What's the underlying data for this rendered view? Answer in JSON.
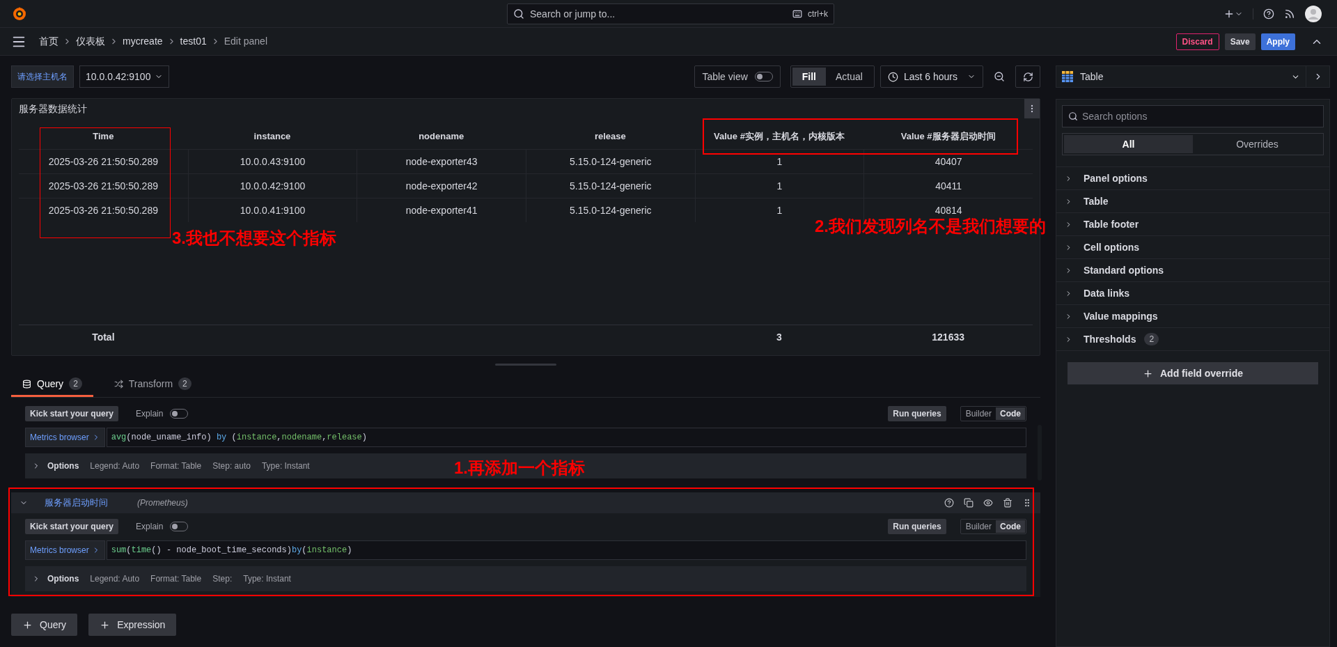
{
  "topbar": {
    "search": {
      "placeholder": "Search or jump to...",
      "shortcut": "ctrl+k"
    }
  },
  "breadcrumbs": [
    {
      "label": "首页"
    },
    {
      "label": "仪表板"
    },
    {
      "label": "mycreate"
    },
    {
      "label": "test01"
    },
    {
      "label": "Edit panel",
      "current": true
    }
  ],
  "actions": [
    {
      "label": "Discard",
      "kind": "danger"
    },
    {
      "label": "Save",
      "kind": "secondary"
    },
    {
      "label": "Apply",
      "kind": "primary"
    }
  ],
  "variable": {
    "label": "请选择主机名",
    "value": "10.0.0.42:9100"
  },
  "toolbar": {
    "table_view": {
      "label": "Table view",
      "on": false
    },
    "modes": [
      {
        "label": "Fill",
        "selected": true
      },
      {
        "label": "Actual",
        "selected": false
      }
    ],
    "time_range": "Last 6 hours"
  },
  "panel": {
    "title": "服务器数据统计",
    "columns": [
      "Time",
      "instance",
      "nodename",
      "release",
      "Value #实例，主机名，内核版本",
      "Value #服务器启动时间"
    ],
    "rows": [
      [
        "2025-03-26 21:50:50.289",
        "10.0.0.43:9100",
        "node-exporter43",
        "5.15.0-124-generic",
        "1",
        "40407"
      ],
      [
        "2025-03-26 21:50:50.289",
        "10.0.0.42:9100",
        "node-exporter42",
        "5.15.0-124-generic",
        "1",
        "40411"
      ],
      [
        "2025-03-26 21:50:50.289",
        "10.0.0.41:9100",
        "node-exporter41",
        "5.15.0-124-generic",
        "1",
        "40814"
      ]
    ],
    "footer": {
      "label": "Total",
      "value_totals": [
        "3",
        "121633"
      ]
    }
  },
  "query_tabs": [
    {
      "label": "Query",
      "count": "2",
      "selected": true
    },
    {
      "label": "Transform",
      "count": "2",
      "selected": false
    }
  ],
  "queries": [
    {
      "kick_start": "Kick start your query",
      "explain": {
        "label": "Explain",
        "on": false
      },
      "run": "Run queries",
      "editor_modes": [
        {
          "label": "Builder",
          "selected": false
        },
        {
          "label": "Code",
          "selected": true
        }
      ],
      "metrics_browser": "Metrics browser",
      "tokens": [
        {
          "text": "avg",
          "kind": "fn"
        },
        {
          "text": "(node_uname_info) ",
          "kind": "text"
        },
        {
          "text": "by",
          "kind": "keyword"
        },
        {
          "text": " (",
          "kind": "text"
        },
        {
          "text": "instance",
          "kind": "label"
        },
        {
          "text": ",",
          "kind": "text"
        },
        {
          "text": "nodename",
          "kind": "label"
        },
        {
          "text": ",",
          "kind": "text"
        },
        {
          "text": "release",
          "kind": "label"
        },
        {
          "text": ")",
          "kind": "text"
        }
      ],
      "options": {
        "title": "Options",
        "items": [
          "Legend: Auto",
          "Format: Table",
          "Step: auto",
          "Type: Instant"
        ]
      }
    },
    {
      "header": {
        "name": "服务器启动时间",
        "datasource": "(Prometheus)",
        "expanded": true
      },
      "kick_start": "Kick start your query",
      "explain": {
        "label": "Explain",
        "on": false
      },
      "run": "Run queries",
      "editor_modes": [
        {
          "label": "Builder",
          "selected": false
        },
        {
          "label": "Code",
          "selected": true
        }
      ],
      "metrics_browser": "Metrics browser",
      "tokens": [
        {
          "text": "sum",
          "kind": "fn"
        },
        {
          "text": "(",
          "kind": "text"
        },
        {
          "text": "time",
          "kind": "fn"
        },
        {
          "text": "() - node_boot_time_seconds)",
          "kind": "text"
        },
        {
          "text": "by",
          "kind": "keyword"
        },
        {
          "text": "(",
          "kind": "text"
        },
        {
          "text": "instance",
          "kind": "label"
        },
        {
          "text": ")",
          "kind": "text"
        }
      ],
      "options": {
        "title": "Options",
        "items": [
          "Legend: Auto",
          "Format: Table",
          "Step:",
          "Type: Instant"
        ]
      }
    }
  ],
  "add_buttons": [
    "Query",
    "Expression"
  ],
  "options_pane": {
    "visualization": "Table",
    "search": {
      "placeholder": "Search options"
    },
    "tabs": [
      {
        "label": "All",
        "selected": true
      },
      {
        "label": "Overrides",
        "selected": false
      }
    ],
    "sections": [
      {
        "label": "Panel options"
      },
      {
        "label": "Table"
      },
      {
        "label": "Table footer"
      },
      {
        "label": "Cell options"
      },
      {
        "label": "Standard options"
      },
      {
        "label": "Data links"
      },
      {
        "label": "Value mappings"
      },
      {
        "label": "Thresholds",
        "count": "2"
      }
    ],
    "add_override": "Add field override"
  },
  "annotations": [
    {
      "text": "3.我也不想要这个指标"
    },
    {
      "text": "2.我们发现列名不是我们想要的"
    },
    {
      "text": "1.再添加一个指标"
    }
  ]
}
